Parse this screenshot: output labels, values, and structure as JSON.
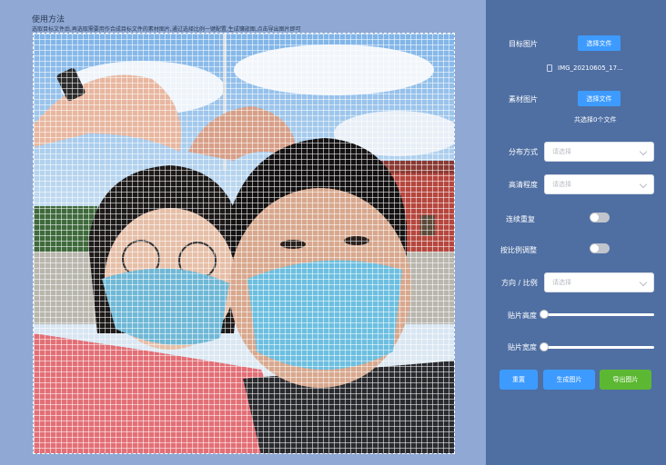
{
  "help": {
    "title": "使用方法",
    "text": "选取目标文件后,再选取需要用作合成目标文件的素材图片,通过选择比例一键配置,生成镶嵌图,点击导出图片即可"
  },
  "panel": {
    "target": {
      "label": "目标图片",
      "button": "选择文件",
      "file_name": "IMG_20210605_17..."
    },
    "material": {
      "label": "素材图片",
      "button": "选择文件",
      "count": "共选择0个文件"
    },
    "distribution": {
      "label": "分布方式",
      "placeholder": "请选择"
    },
    "clarity": {
      "label": "高清程度",
      "placeholder": "请选择"
    },
    "repeat": {
      "label": "连续重复",
      "on": false
    },
    "ratio_adjust": {
      "label": "按比例调整",
      "on": false
    },
    "direction": {
      "label": "方向 / 比例",
      "placeholder": "请选择"
    },
    "tile_height": {
      "label": "贴片高度",
      "value": 0
    },
    "tile_width": {
      "label": "贴片宽度",
      "value": 0
    },
    "actions": {
      "reset": "重置",
      "generate": "生成图片",
      "export": "导出图片"
    }
  },
  "colors": {
    "primary": "#3d9bff",
    "success": "#5cb832",
    "panel_bg": "#4f6fa3",
    "left_bg": "#8fa9d4"
  }
}
